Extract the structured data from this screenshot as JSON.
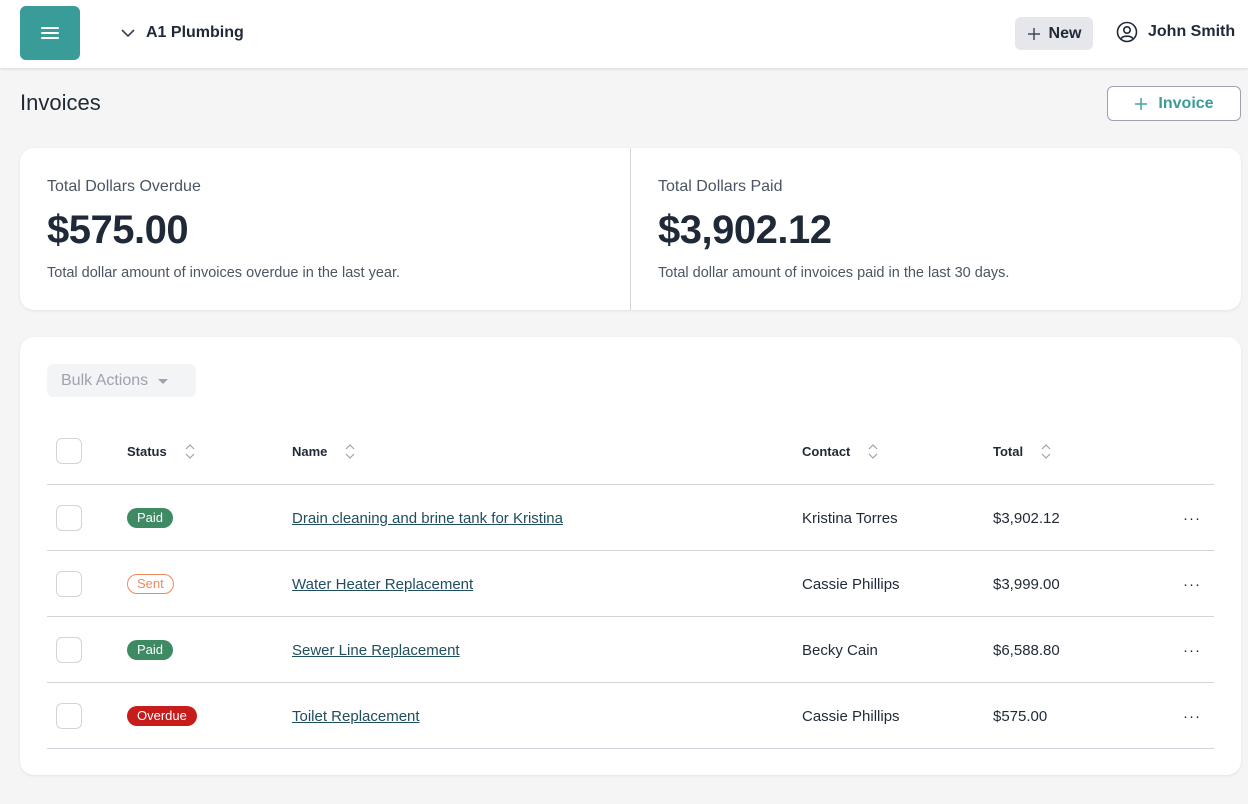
{
  "header": {
    "company": "A1 Plumbing",
    "new_label": "New",
    "user_name": "John Smith"
  },
  "page": {
    "title": "Invoices",
    "add_invoice_label": "Invoice"
  },
  "stats": [
    {
      "label": "Total Dollars Overdue",
      "value": "$575.00",
      "description": "Total dollar amount of invoices overdue in the last year."
    },
    {
      "label": "Total Dollars Paid",
      "value": "$3,902.12",
      "description": "Total dollar amount of invoices paid in the last 30 days."
    }
  ],
  "table": {
    "bulk_actions_label": "Bulk Actions",
    "columns": {
      "status": "Status",
      "name": "Name",
      "contact": "Contact",
      "total": "Total"
    },
    "rows": [
      {
        "status": "Paid",
        "name": "Drain cleaning and brine tank for Kristina",
        "contact": "Kristina Torres",
        "total": "$3,902.12",
        "more": "···"
      },
      {
        "status": "Sent",
        "name": "Water Heater Replacement",
        "contact": "Cassie Phillips",
        "total": "$3,999.00",
        "more": "···"
      },
      {
        "status": "Paid",
        "name": "Sewer Line Replacement",
        "contact": "Becky Cain",
        "total": "$6,588.80",
        "more": "···"
      },
      {
        "status": "Overdue",
        "name": "Toilet Replacement",
        "contact": "Cassie Phillips",
        "total": "$575.00",
        "more": "···"
      }
    ]
  },
  "colors": {
    "accent": "#3a9c98",
    "paid_bg": "#3d8a63",
    "sent_border": "#f08a5d",
    "overdue_bg": "#c71c1c"
  }
}
